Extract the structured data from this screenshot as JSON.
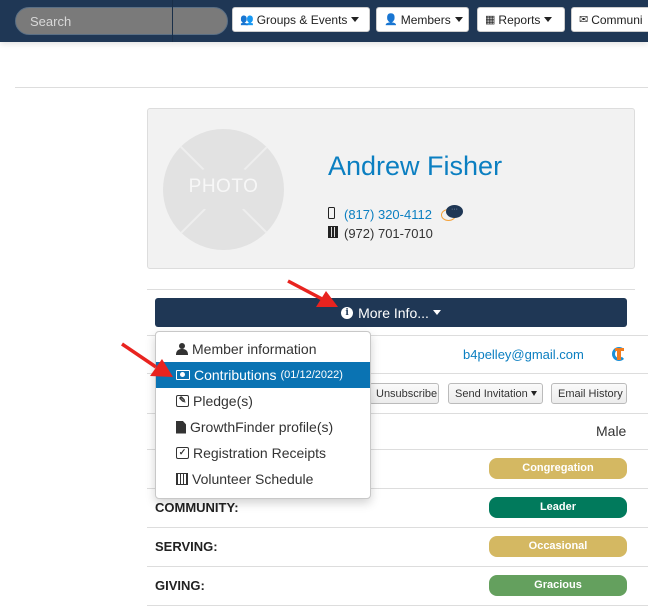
{
  "topnav": {
    "search_placeholder": "Search",
    "menus": [
      {
        "icon": "group-icon",
        "label": "Groups & Events"
      },
      {
        "icon": "user-icon",
        "label": "Members"
      },
      {
        "icon": "table-icon",
        "label": "Reports"
      },
      {
        "icon": "envelope-icon",
        "label": "Communi"
      }
    ]
  },
  "profile": {
    "photo_placeholder": "PHOTO",
    "name": "Andrew Fisher",
    "mobile_phone": "(817) 320-4112",
    "office_phone": "(972) 701-7010"
  },
  "more_info": {
    "label": "More Info..."
  },
  "dropdown": {
    "items": [
      {
        "icon": "user-icon",
        "label": "Member information",
        "active": false
      },
      {
        "icon": "money-icon",
        "label": "Contributions",
        "date": "(01/12/2022)",
        "active": true
      },
      {
        "icon": "edit-icon",
        "label": "Pledge(s)",
        "active": false
      },
      {
        "icon": "file-icon",
        "label": "GrowthFinder profile(s)",
        "active": false
      },
      {
        "icon": "check-square-icon",
        "label": "Registration Receipts",
        "active": false
      },
      {
        "icon": "calendar-icon",
        "label": "Volunteer Schedule",
        "active": false
      }
    ]
  },
  "details": {
    "email": "b4pelley@gmail.com",
    "email_buttons": [
      "Unsubscribe",
      "Send Invitation",
      "Email History"
    ],
    "gender": "Male",
    "engagement": [
      {
        "label": "",
        "value": "Congregation",
        "color": "#d4b862"
      },
      {
        "label": "COMMUNITY:",
        "value": "Leader",
        "color": "#017a5c"
      },
      {
        "label": "SERVING:",
        "value": "Occasional",
        "color": "#d4b862"
      },
      {
        "label": "GIVING:",
        "value": "Gracious",
        "color": "#64a05e"
      }
    ]
  },
  "colors": {
    "navbar": "#1f3755",
    "link": "#0b7fc1",
    "active_menu": "#0a73b3",
    "annotation_arrow": "#e8231f"
  }
}
